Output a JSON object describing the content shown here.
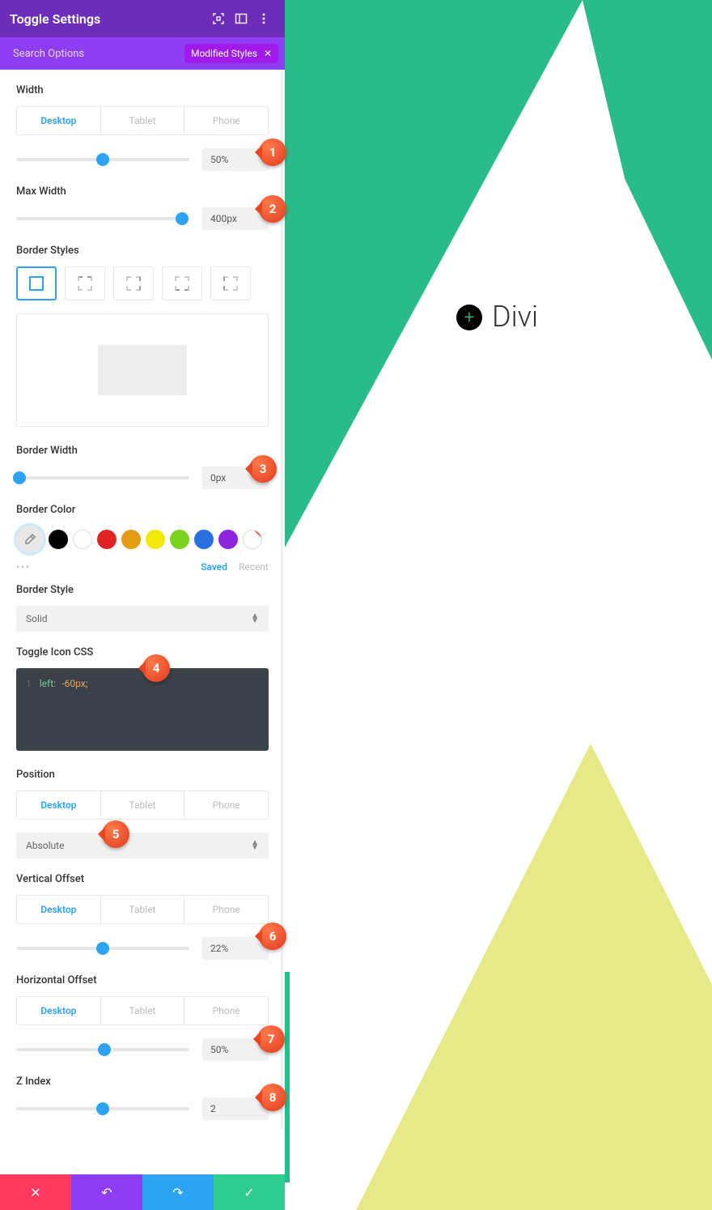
{
  "header": {
    "title": "Toggle Settings"
  },
  "search": {
    "placeholder": "Search Options",
    "pill_label": "Modified Styles"
  },
  "device_tabs": {
    "desktop": "Desktop",
    "tablet": "Tablet",
    "phone": "Phone"
  },
  "sections": {
    "width": {
      "label": "Width",
      "value": "50%",
      "slider_pct": 50
    },
    "max_width": {
      "label": "Max Width",
      "value": "400px",
      "slider_pct": 96
    },
    "border_styles": {
      "label": "Border Styles"
    },
    "border_width": {
      "label": "Border Width",
      "value": "0px",
      "slider_pct": 2
    },
    "border_color": {
      "label": "Border Color",
      "swatches": [
        "#000000",
        "#ffffff",
        "#e02424",
        "#e39c14",
        "#f2e90b",
        "#7bd321",
        "#2a6fe0",
        "#8e24e0"
      ],
      "saved": "Saved",
      "recent": "Recent"
    },
    "border_style": {
      "label": "Border Style",
      "value": "Solid"
    },
    "toggle_icon_css": {
      "label": "Toggle Icon CSS",
      "line_no": "1",
      "key": "left:",
      "val": "-60px;"
    },
    "position": {
      "label": "Position",
      "value": "Absolute"
    },
    "vertical_offset": {
      "label": "Vertical Offset",
      "value": "22%",
      "slider_pct": 50
    },
    "horizontal_offset": {
      "label": "Horizontal Offset",
      "value": "50%",
      "slider_pct": 51
    },
    "z_index": {
      "label": "Z Index",
      "value": "2",
      "slider_pct": 50
    }
  },
  "callouts": {
    "c1": "1",
    "c2": "2",
    "c3": "3",
    "c4": "4",
    "c5": "5",
    "c6": "6",
    "c7": "7",
    "c8": "8"
  },
  "canvas": {
    "brand": "Divi"
  }
}
